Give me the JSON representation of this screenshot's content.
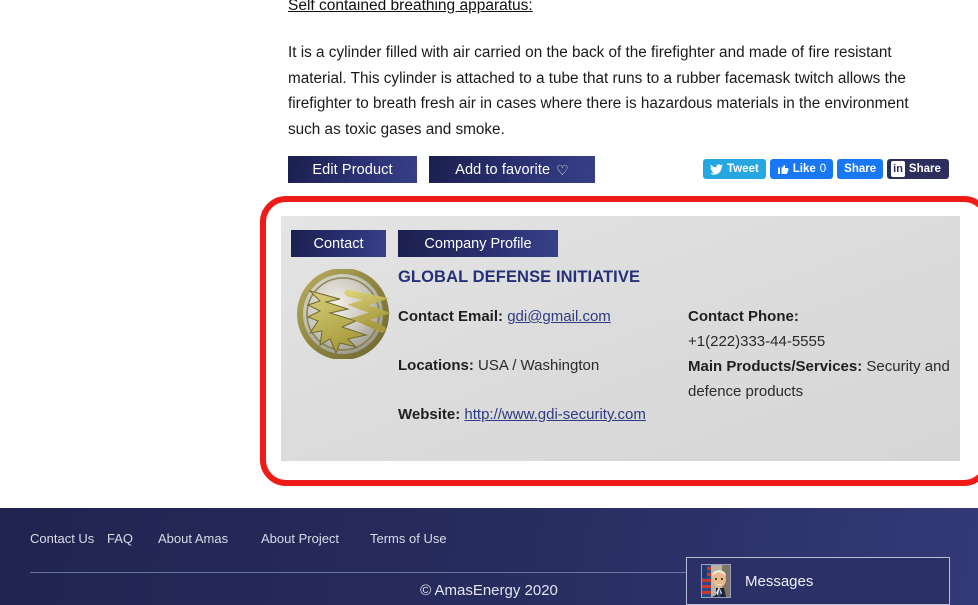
{
  "product": {
    "heading": "Self contained breathing apparatus:",
    "description": "It is a cylinder filled with air carried on the back of the firefighter and made of fire resistant material. This cylinder is attached to a tube that runs to a rubber facemask twitch allows the firefighter to breath fresh air in cases where there is hazardous materials in the environment such as toxic gases and smoke."
  },
  "actions": {
    "edit_label": "Edit Product",
    "favorite_label": "Add to favorite"
  },
  "social": {
    "tweet_label": "Tweet",
    "like_label": "Like",
    "like_count": "0",
    "facebook_share_label": "Share",
    "linkedin_badge": "in",
    "linkedin_share_label": "Share"
  },
  "company_card": {
    "tabs": [
      {
        "label": "Contact",
        "active": true
      },
      {
        "label": "Company Profile",
        "active": false
      }
    ],
    "name": "GLOBAL DEFENSE INITIATIVE",
    "fields": {
      "email_label": "Contact Email:",
      "email_value": "gdi@gmail.com",
      "locations_label": "Locations:",
      "locations_value": "USA / Washington",
      "website_label": "Website:",
      "website_value": "http://www.gdi-security.com",
      "phone_label": "Contact Phone:",
      "phone_value": "+1(222)333-44-5555",
      "products_label": "Main Products/Services:",
      "products_value": "Security and defence products"
    }
  },
  "annotation": {
    "color": "#ef1b17"
  },
  "footer": {
    "links": [
      "Contact Us",
      "FAQ",
      "About Amas",
      "About Project",
      "Terms of Use"
    ],
    "copyright": "© AmasEnergy 2020"
  },
  "messages_widget": {
    "label": "Messages"
  }
}
